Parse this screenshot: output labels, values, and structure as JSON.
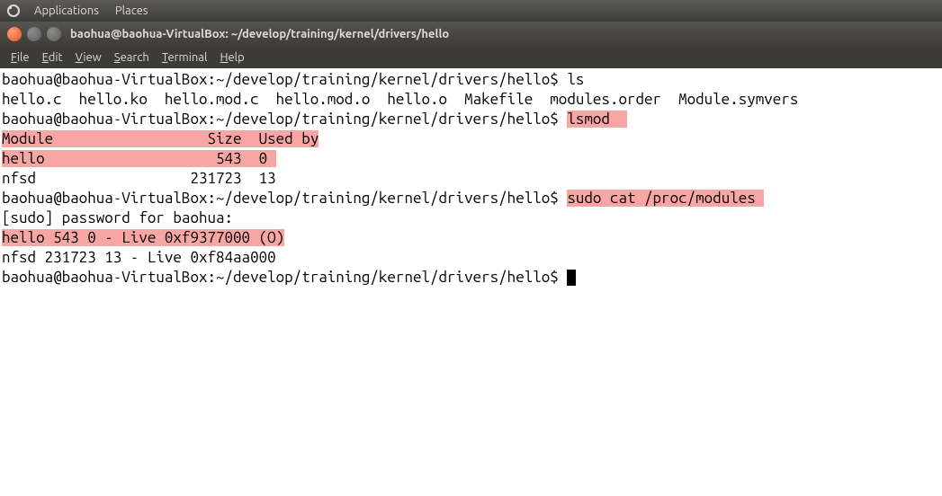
{
  "top_panel": {
    "applications": "Applications",
    "places": "Places"
  },
  "window": {
    "title": "baohua@baohua-VirtualBox: ~/develop/training/kernel/drivers/hello"
  },
  "menu": {
    "file": "File",
    "edit": "Edit",
    "view": "View",
    "search": "Search",
    "terminal": "Terminal",
    "help": "Help"
  },
  "terminal": {
    "prompt": "baohua@baohua-VirtualBox:~/develop/training/kernel/drivers/hello$ ",
    "cmd_ls": "ls",
    "ls_output": "hello.c  hello.ko  hello.mod.c  hello.mod.o  hello.o  Makefile  modules.order  Module.symvers",
    "cmd_lsmod": "lsmod  ",
    "lsmod_header": "Module                  Size  Used by",
    "lsmod_hello": "hello                    543  0 ",
    "lsmod_nfsd": "nfsd                  231723  13 ",
    "cmd_cat": "sudo cat /proc/modules ",
    "sudo_prompt": "[sudo] password for baohua: ",
    "proc_hello": "hello 543 0 - Live 0xf9377000 (O)",
    "proc_nfsd": "nfsd 231723 13 - Live 0xf84aa000"
  },
  "highlights": {
    "color": "#f7a6a4"
  }
}
